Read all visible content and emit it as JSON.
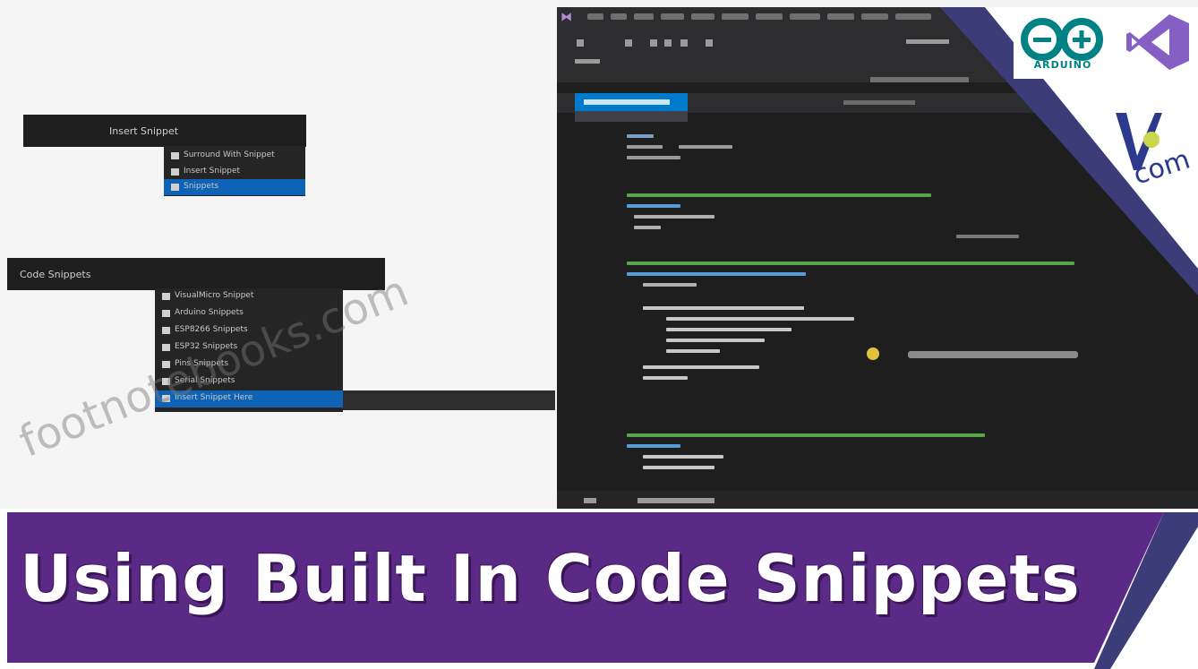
{
  "watermark": "footnotebooks.com",
  "banner": {
    "title": "Using Built In Code Snippets",
    "bg_color": "#5b2a86",
    "accent_color": "#3c3c78"
  },
  "menu1": {
    "header": "Insert Snippet",
    "items": [
      "Surround With Snippet",
      "Insert Snippet",
      "Snippets"
    ]
  },
  "menu2": {
    "header": "Code Snippets",
    "items": [
      "VisualMicro Snippet",
      "Arduino Snippets",
      "ESP8266 Snippets",
      "ESP32 Snippets",
      "Pins Snippets",
      "Serial Snippets",
      "Insert Snippet Here"
    ]
  },
  "logos": {
    "arduino": "ARDUINO",
    "arduino_color": "#008184",
    "visual_studio": "vs-logo",
    "vm": "VM"
  },
  "ide": {
    "accent": "#007acc",
    "background": "#1e1e1e"
  }
}
